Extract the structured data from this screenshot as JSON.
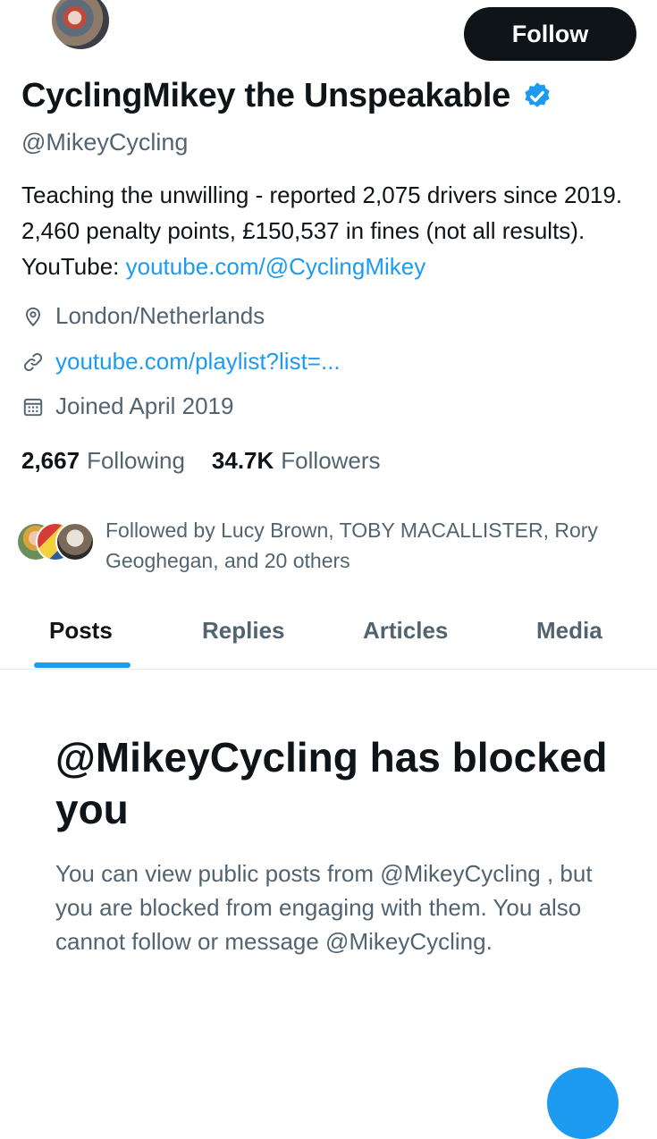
{
  "profile": {
    "display_name": "CyclingMikey the Unspeakable",
    "handle": "@MikeyCycling",
    "follow_label": "Follow",
    "bio_text": "Teaching the unwilling - reported 2,075 drivers since 2019. 2,460 penalty points, £150,537 in fines (not all results). YouTube: ",
    "bio_link": "youtube.com/@CyclingMikey",
    "location": "London/Netherlands",
    "website": "youtube.com/playlist?list=...",
    "joined": "Joined April 2019"
  },
  "stats": {
    "following_count": "2,667",
    "following_label": "Following",
    "followers_count": "34.7K",
    "followers_label": "Followers"
  },
  "followed_by": "Followed by Lucy Brown, TOBY MACALLISTER, Rory Geoghegan, and 20 others",
  "tabs": [
    {
      "label": "Posts",
      "active": true
    },
    {
      "label": "Replies",
      "active": false
    },
    {
      "label": "Articles",
      "active": false
    },
    {
      "label": "Media",
      "active": false
    }
  ],
  "blocked": {
    "title": "@MikeyCycling has blocked you",
    "description": "You can view public posts from @MikeyCycling , but you are blocked from engaging with them. You also cannot follow or message @MikeyCycling."
  },
  "icons": {
    "verified": "verified-badge-icon",
    "location": "location-pin-icon",
    "website": "link-icon",
    "joined": "calendar-icon"
  },
  "colors": {
    "accent": "#1d9bf0",
    "text": "#0f1419",
    "secondary_text": "#536471",
    "button_bg": "#0f1419"
  }
}
